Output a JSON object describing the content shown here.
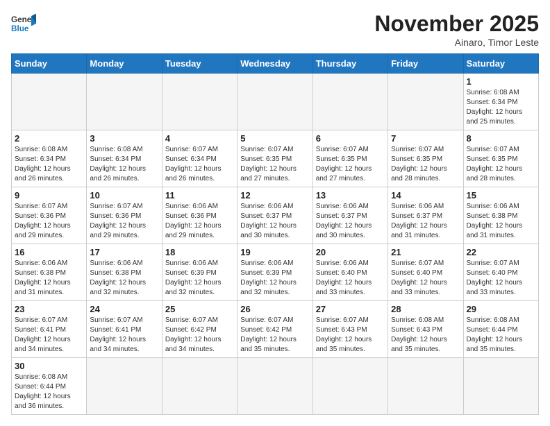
{
  "header": {
    "logo_general": "General",
    "logo_blue": "Blue",
    "month_title": "November 2025",
    "location": "Ainaro, Timor Leste"
  },
  "weekdays": [
    "Sunday",
    "Monday",
    "Tuesday",
    "Wednesday",
    "Thursday",
    "Friday",
    "Saturday"
  ],
  "weeks": [
    [
      {
        "day": "",
        "info": ""
      },
      {
        "day": "",
        "info": ""
      },
      {
        "day": "",
        "info": ""
      },
      {
        "day": "",
        "info": ""
      },
      {
        "day": "",
        "info": ""
      },
      {
        "day": "",
        "info": ""
      },
      {
        "day": "1",
        "info": "Sunrise: 6:08 AM\nSunset: 6:34 PM\nDaylight: 12 hours\nand 25 minutes."
      }
    ],
    [
      {
        "day": "2",
        "info": "Sunrise: 6:08 AM\nSunset: 6:34 PM\nDaylight: 12 hours\nand 26 minutes."
      },
      {
        "day": "3",
        "info": "Sunrise: 6:08 AM\nSunset: 6:34 PM\nDaylight: 12 hours\nand 26 minutes."
      },
      {
        "day": "4",
        "info": "Sunrise: 6:07 AM\nSunset: 6:34 PM\nDaylight: 12 hours\nand 26 minutes."
      },
      {
        "day": "5",
        "info": "Sunrise: 6:07 AM\nSunset: 6:35 PM\nDaylight: 12 hours\nand 27 minutes."
      },
      {
        "day": "6",
        "info": "Sunrise: 6:07 AM\nSunset: 6:35 PM\nDaylight: 12 hours\nand 27 minutes."
      },
      {
        "day": "7",
        "info": "Sunrise: 6:07 AM\nSunset: 6:35 PM\nDaylight: 12 hours\nand 28 minutes."
      },
      {
        "day": "8",
        "info": "Sunrise: 6:07 AM\nSunset: 6:35 PM\nDaylight: 12 hours\nand 28 minutes."
      }
    ],
    [
      {
        "day": "9",
        "info": "Sunrise: 6:07 AM\nSunset: 6:36 PM\nDaylight: 12 hours\nand 29 minutes."
      },
      {
        "day": "10",
        "info": "Sunrise: 6:07 AM\nSunset: 6:36 PM\nDaylight: 12 hours\nand 29 minutes."
      },
      {
        "day": "11",
        "info": "Sunrise: 6:06 AM\nSunset: 6:36 PM\nDaylight: 12 hours\nand 29 minutes."
      },
      {
        "day": "12",
        "info": "Sunrise: 6:06 AM\nSunset: 6:37 PM\nDaylight: 12 hours\nand 30 minutes."
      },
      {
        "day": "13",
        "info": "Sunrise: 6:06 AM\nSunset: 6:37 PM\nDaylight: 12 hours\nand 30 minutes."
      },
      {
        "day": "14",
        "info": "Sunrise: 6:06 AM\nSunset: 6:37 PM\nDaylight: 12 hours\nand 31 minutes."
      },
      {
        "day": "15",
        "info": "Sunrise: 6:06 AM\nSunset: 6:38 PM\nDaylight: 12 hours\nand 31 minutes."
      }
    ],
    [
      {
        "day": "16",
        "info": "Sunrise: 6:06 AM\nSunset: 6:38 PM\nDaylight: 12 hours\nand 31 minutes."
      },
      {
        "day": "17",
        "info": "Sunrise: 6:06 AM\nSunset: 6:38 PM\nDaylight: 12 hours\nand 32 minutes."
      },
      {
        "day": "18",
        "info": "Sunrise: 6:06 AM\nSunset: 6:39 PM\nDaylight: 12 hours\nand 32 minutes."
      },
      {
        "day": "19",
        "info": "Sunrise: 6:06 AM\nSunset: 6:39 PM\nDaylight: 12 hours\nand 32 minutes."
      },
      {
        "day": "20",
        "info": "Sunrise: 6:06 AM\nSunset: 6:40 PM\nDaylight: 12 hours\nand 33 minutes."
      },
      {
        "day": "21",
        "info": "Sunrise: 6:07 AM\nSunset: 6:40 PM\nDaylight: 12 hours\nand 33 minutes."
      },
      {
        "day": "22",
        "info": "Sunrise: 6:07 AM\nSunset: 6:40 PM\nDaylight: 12 hours\nand 33 minutes."
      }
    ],
    [
      {
        "day": "23",
        "info": "Sunrise: 6:07 AM\nSunset: 6:41 PM\nDaylight: 12 hours\nand 34 minutes."
      },
      {
        "day": "24",
        "info": "Sunrise: 6:07 AM\nSunset: 6:41 PM\nDaylight: 12 hours\nand 34 minutes."
      },
      {
        "day": "25",
        "info": "Sunrise: 6:07 AM\nSunset: 6:42 PM\nDaylight: 12 hours\nand 34 minutes."
      },
      {
        "day": "26",
        "info": "Sunrise: 6:07 AM\nSunset: 6:42 PM\nDaylight: 12 hours\nand 35 minutes."
      },
      {
        "day": "27",
        "info": "Sunrise: 6:07 AM\nSunset: 6:43 PM\nDaylight: 12 hours\nand 35 minutes."
      },
      {
        "day": "28",
        "info": "Sunrise: 6:08 AM\nSunset: 6:43 PM\nDaylight: 12 hours\nand 35 minutes."
      },
      {
        "day": "29",
        "info": "Sunrise: 6:08 AM\nSunset: 6:44 PM\nDaylight: 12 hours\nand 35 minutes."
      }
    ],
    [
      {
        "day": "30",
        "info": "Sunrise: 6:08 AM\nSunset: 6:44 PM\nDaylight: 12 hours\nand 36 minutes."
      },
      {
        "day": "",
        "info": ""
      },
      {
        "day": "",
        "info": ""
      },
      {
        "day": "",
        "info": ""
      },
      {
        "day": "",
        "info": ""
      },
      {
        "day": "",
        "info": ""
      },
      {
        "day": "",
        "info": ""
      }
    ]
  ]
}
